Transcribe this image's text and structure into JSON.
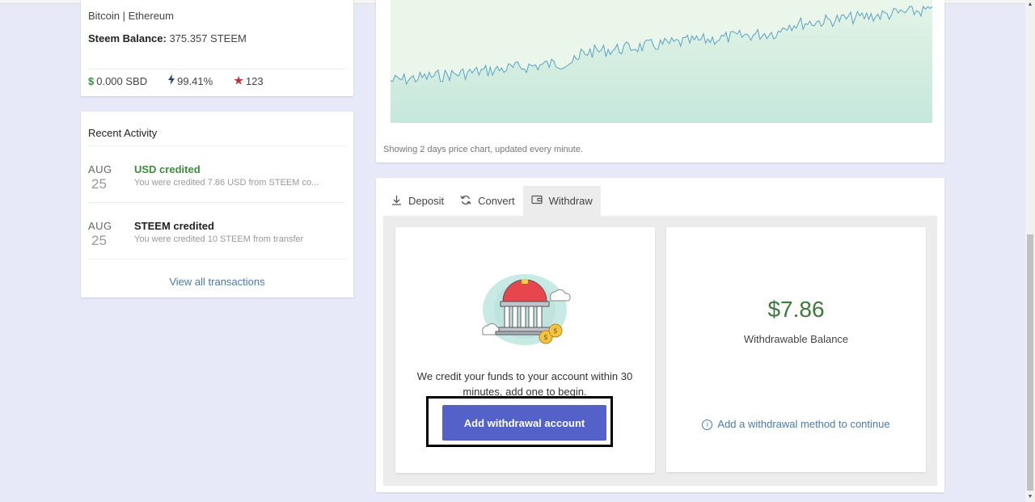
{
  "profile": {
    "line0": "",
    "coins": "Bitcoin | Ethereum",
    "balance_label": "Steem Balance:",
    "balance_value": "375.357 STEEM",
    "sbd": "0.000 SBD",
    "voting_power": "99.41%",
    "reputation": "123",
    "icons": [
      "dollar-icon",
      "lightning-icon",
      "star-icon"
    ]
  },
  "activity": {
    "title": "Recent Activity",
    "items": [
      {
        "month": "AUG",
        "day": "25",
        "name": "USD credited",
        "desc": "You were credited 7.86 USD from STEEM co...",
        "color": "#3c8d3c"
      },
      {
        "month": "AUG",
        "day": "25",
        "name": "STEEM credited",
        "desc": "You were credited 10 STEEM from transfer",
        "color": "#222222"
      }
    ],
    "view_all": "View all transactions"
  },
  "chart": {
    "caption": "Showing 2 days price chart, updated every minute.",
    "colors": {
      "line": "#5aa3c2",
      "fill_top": "#e2f3e6",
      "fill_bottom": "#c6e7dc"
    }
  },
  "wallet": {
    "tabs": [
      {
        "label": "Deposit",
        "icon": "download-icon"
      },
      {
        "label": "Convert",
        "icon": "refresh-icon"
      },
      {
        "label": "Withdraw",
        "icon": "wallet-icon",
        "active": true
      }
    ],
    "credit_text": "We credit your funds to your account within 30 minutes, add one to begin.",
    "add_button": "Add withdrawal account",
    "amount": "$7.86",
    "amount_label": "Withdrawable Balance",
    "add_method": "Add a withdrawal method to continue",
    "accent": "#5361c8"
  }
}
